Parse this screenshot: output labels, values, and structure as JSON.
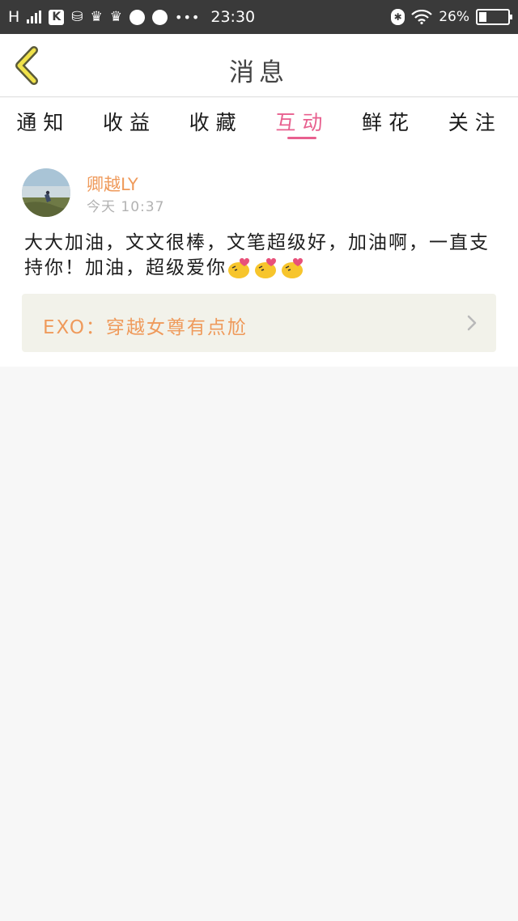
{
  "status_bar": {
    "network": "H",
    "icon_k": "K",
    "time": "23:30",
    "battery_percent": "26%",
    "battery_level": 0.26,
    "icons": [
      "signal-icon",
      "k-app-icon",
      "data-icon",
      "crown-icon",
      "crown-icon",
      "app-icon",
      "planet-icon",
      "more-dots-icon",
      "bluetooth-icon",
      "wifi-icon",
      "battery-icon"
    ]
  },
  "header": {
    "title": "消息",
    "back_icon": "chevron-left-icon"
  },
  "tabs": [
    {
      "label": "通知",
      "active": false
    },
    {
      "label": "收益",
      "active": false
    },
    {
      "label": "收藏",
      "active": false
    },
    {
      "label": "互动",
      "active": true
    },
    {
      "label": "鲜花",
      "active": false
    },
    {
      "label": "关注",
      "active": false
    }
  ],
  "message": {
    "username": "卿越LY",
    "time": "今天  10:37",
    "content": "大大加油，文文很棒，文笔超级好，加油啊，一直支持你！加油，超级爱你",
    "emoji_count": 3,
    "emoji_icon": "kiss-emoji-icon",
    "book_link": "EXO：穿越女尊有点尬",
    "book_link_icon": "chevron-right-icon"
  },
  "colors": {
    "active_tab": "#e8608f",
    "accent_orange": "#ef9a5b",
    "status_bar_bg": "#3a3a3a",
    "back_icon": "#f0e24a"
  }
}
